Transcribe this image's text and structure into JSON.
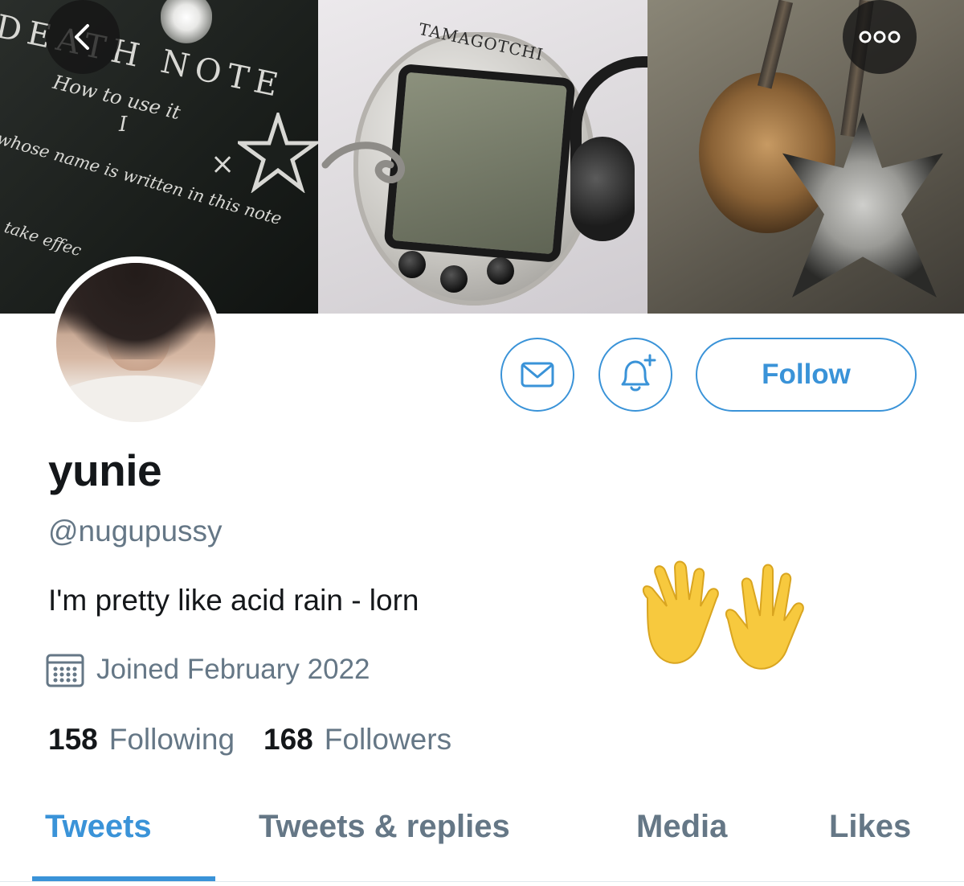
{
  "banner": {
    "death_note": {
      "title": "DEATH NOTE",
      "subtitle": "How to use it",
      "number": "I",
      "rule": "whose name is written in this note",
      "take": "take effec",
      "x_mark": "×"
    },
    "tamagotchi_label": "TAMAGOTCHI"
  },
  "nav": {
    "back_icon": "chevron-left-icon",
    "more_icon": "more-dots-icon"
  },
  "profile": {
    "display_name": "yunie",
    "handle": "@nugupussy",
    "bio": "I'm pretty like acid rain - lorn",
    "bio_emoji": "raised-hands-emoji",
    "joined": "Joined February 2022",
    "following_count": "158",
    "following_label": "Following",
    "followers_count": "168",
    "followers_label": "Followers"
  },
  "actions": {
    "message_icon": "envelope-icon",
    "notify_icon": "bell-plus-icon",
    "follow_label": "Follow"
  },
  "tabs": [
    {
      "label": "Tweets",
      "active": true
    },
    {
      "label": "Tweets & replies",
      "active": false
    },
    {
      "label": "Media",
      "active": false
    },
    {
      "label": "Likes",
      "active": false
    }
  ],
  "colors": {
    "accent": "#3a93d8",
    "text_primary": "#14171a",
    "text_secondary": "#657786"
  }
}
